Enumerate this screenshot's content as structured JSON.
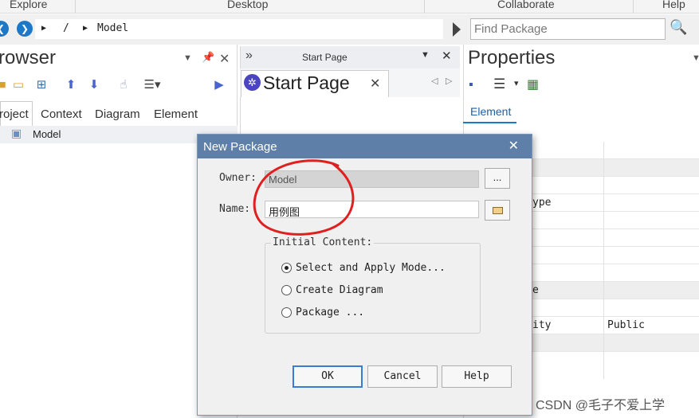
{
  "ribbon": {
    "tabs": [
      "Explore",
      "Desktop",
      "Collaborate",
      "Help"
    ]
  },
  "address": {
    "root": "/",
    "path": "Model",
    "find_placeholder": "Find Package"
  },
  "browser": {
    "title": "rowser",
    "tabs": [
      "roject",
      "Context",
      "Diagram",
      "Element"
    ],
    "tree_item": "Model"
  },
  "start_page": {
    "header": "Start Page",
    "tab_label": "Start Page"
  },
  "properties": {
    "title": "Properties",
    "tab": "Element",
    "rows": [
      {
        "key": "",
        "value": ""
      },
      {
        "key": "",
        "value": ""
      },
      {
        "key": "",
        "value": ""
      },
      {
        "key": "ype",
        "value": ""
      },
      {
        "key": "",
        "value": ""
      },
      {
        "key": "",
        "value": ""
      },
      {
        "key": "",
        "value": ""
      },
      {
        "key": "",
        "value": ""
      },
      {
        "key": "e",
        "value": ""
      },
      {
        "key": "",
        "value": ""
      },
      {
        "key": "ity",
        "value": "Public"
      },
      {
        "key": "",
        "value": ""
      }
    ]
  },
  "dialog": {
    "title": "New Package",
    "owner_label": "Owner:",
    "owner_value": "Model",
    "owner_button": "...",
    "name_label": "Name:",
    "name_value": "用例图",
    "group_title": "Initial Content:",
    "options": [
      {
        "label": "Select and Apply Mode...",
        "selected": true
      },
      {
        "label": "Create Diagram",
        "selected": false
      },
      {
        "label": "Package ...",
        "selected": false
      }
    ],
    "ok_label": "OK",
    "cancel_label": "Cancel",
    "help_label": "Help"
  },
  "watermark": "CSDN @毛子不爱上学",
  "colors": {
    "title_bar": "#5d7fa8",
    "accent": "#1e78c8",
    "annotation_red": "#e02020"
  }
}
